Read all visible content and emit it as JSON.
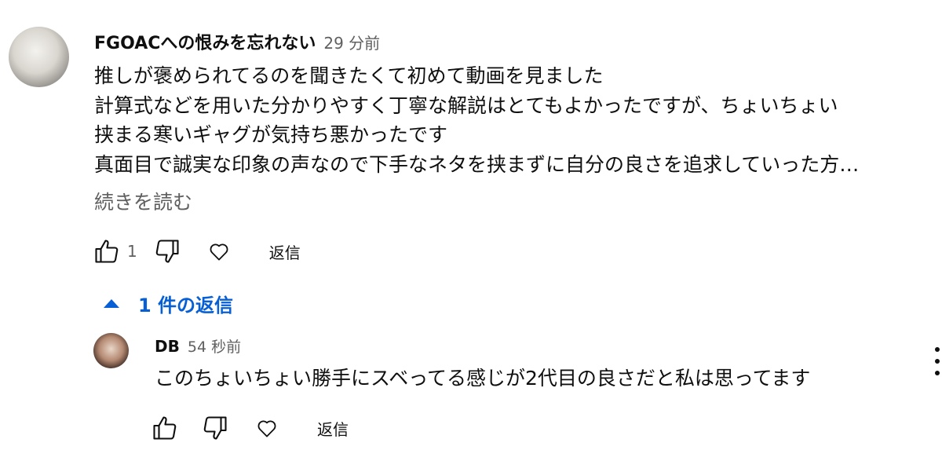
{
  "comment": {
    "author": "FGOACへの恨みを忘れない",
    "time": "29 分前",
    "lines": [
      "推しが褒められてるのを聞きたくて初めて動画を見ました",
      "計算式などを用いた分かりやすく丁寧な解説はとてもよかったですが、ちょいちょい",
      "挟まる寒いギャグが気持ち悪かったです",
      "真面目で誠実な印象の声なので下手なネタを挟まずに自分の良さを追求していった方…"
    ],
    "read_more": "続きを読む",
    "like_count": "1",
    "reply_label": "返信"
  },
  "replies_toggle": {
    "label": "1 件の返信",
    "icon": "triangle-up-icon",
    "color": "#065fd4"
  },
  "reply": {
    "author": "DB",
    "time": "54 秒前",
    "text": "このちょいちょい勝手にスベってる感じが2代目の良さだと私は思ってます",
    "reply_label": "返信"
  },
  "icons": [
    "thumbs-up-icon",
    "thumbs-down-icon",
    "heart-icon",
    "more-vert-icon"
  ]
}
